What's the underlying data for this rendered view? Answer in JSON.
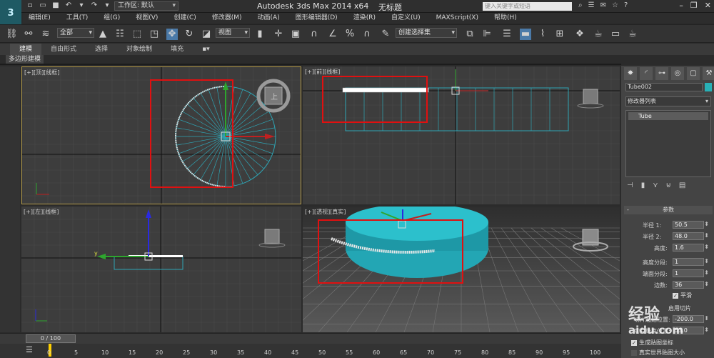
{
  "app": {
    "title": "Autodesk 3ds Max  2014 x64",
    "document": "无标题",
    "logo": "3",
    "workspace": "工作区: 默认",
    "search_placeholder": "键入关键字或短语"
  },
  "menu": [
    "编辑(E)",
    "工具(T)",
    "组(G)",
    "视图(V)",
    "创建(C)",
    "修改器(M)",
    "动画(A)",
    "图形编辑器(D)",
    "渲染(R)",
    "自定义(U)",
    "MAXScript(X)",
    "帮助(H)"
  ],
  "toolbar": {
    "selection_filter": "全部",
    "ref_coord": "视图",
    "named_selection": "创建选择集",
    "scale_label": "%"
  },
  "ribbon": {
    "tabs": [
      "建模",
      "自由形式",
      "选择",
      "对象绘制",
      "填充"
    ],
    "active_tab": 0,
    "sub_tab": "多边形建模"
  },
  "viewports": [
    {
      "id": "top",
      "label": "[+][顶][线框]"
    },
    {
      "id": "front",
      "label": "[+][前][线框]"
    },
    {
      "id": "left",
      "label": "[+][左][线框]"
    },
    {
      "id": "persp",
      "label": "[+][透视][真实]"
    }
  ],
  "axis": {
    "x": "x",
    "y": "y"
  },
  "command_panel": {
    "object_name": "Tube002",
    "object_color": "#28b0b6",
    "modifier_list": "修改器列表",
    "stack_item": "Tube",
    "rollout_title": "参数",
    "params": [
      {
        "label": "半径 1:",
        "value": "50.5"
      },
      {
        "label": "半径 2:",
        "value": "48.0"
      },
      {
        "label": "高度:",
        "value": "1.6"
      },
      {
        "label": "高度分段:",
        "value": "1"
      },
      {
        "label": "端面分段:",
        "value": "1"
      },
      {
        "label": "边数:",
        "value": "36"
      }
    ],
    "smooth_label": "平滑",
    "slice_on_label": "启用切片",
    "slice_from_label": "切片起始位置:",
    "slice_from_value": "-200.0",
    "slice_to_label": "切片结束位置:",
    "slice_to_value": "53.0",
    "gen_map_label": "生成贴图坐标",
    "real_world_label": "真实世界贴图大小"
  },
  "timeline": {
    "slider": "0 / 100",
    "ticks": [
      "0",
      "5",
      "10",
      "15",
      "20",
      "25",
      "30",
      "35",
      "40",
      "45",
      "50",
      "55",
      "60",
      "65",
      "70",
      "75",
      "80",
      "85",
      "90",
      "95",
      "100"
    ]
  },
  "watermark": {
    "line1": "经验",
    "line2": "aidu.com"
  }
}
